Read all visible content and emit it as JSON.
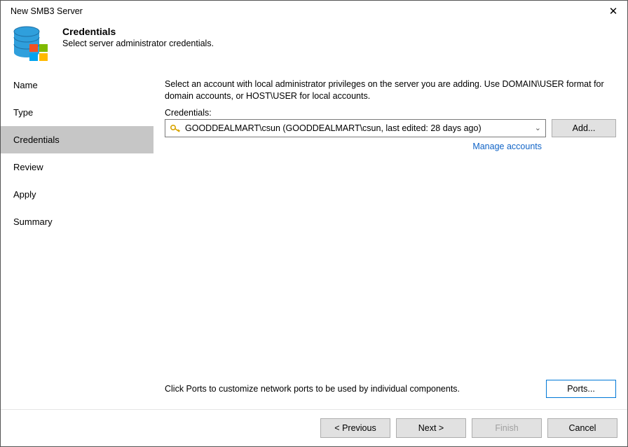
{
  "window": {
    "title": "New SMB3 Server"
  },
  "header": {
    "title": "Credentials",
    "subtitle": "Select server administrator credentials."
  },
  "sidebar": {
    "items": [
      {
        "label": "Name",
        "id": "nav-name",
        "active": false
      },
      {
        "label": "Type",
        "id": "nav-type",
        "active": false
      },
      {
        "label": "Credentials",
        "id": "nav-credentials",
        "active": true
      },
      {
        "label": "Review",
        "id": "nav-review",
        "active": false
      },
      {
        "label": "Apply",
        "id": "nav-apply",
        "active": false
      },
      {
        "label": "Summary",
        "id": "nav-summary",
        "active": false
      }
    ]
  },
  "main": {
    "instructions": "Select an account with local administrator privileges on the server you are adding. Use DOMAIN\\USER format for domain accounts, or HOST\\USER for local accounts.",
    "credentials_label": "Credentials:",
    "credentials_value": "GOODDEALMART\\csun (GOODDEALMART\\csun, last edited: 28 days ago)",
    "add_button": "Add...",
    "manage_link": "Manage accounts",
    "ports_text": "Click Ports to customize network ports to be used by individual components.",
    "ports_button": "Ports..."
  },
  "footer": {
    "previous": "< Previous",
    "next": "Next >",
    "finish": "Finish",
    "cancel": "Cancel"
  }
}
